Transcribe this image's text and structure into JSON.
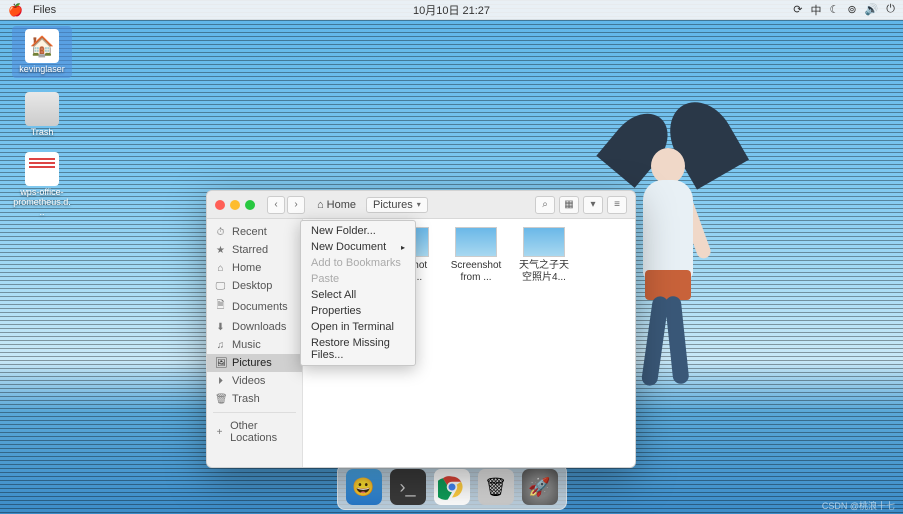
{
  "topbar": {
    "app_name": "Files",
    "clock": "10月10日  21:27"
  },
  "desktop_icons": {
    "home_label": "kevinglaser",
    "trash_label": "Trash",
    "doc_label": "wps-office-prometheus.d..."
  },
  "window": {
    "path_home": "Home",
    "path_current": "Pictures"
  },
  "sidebar": {
    "items": [
      {
        "icon": "⏱",
        "label": "Recent"
      },
      {
        "icon": "★",
        "label": "Starred"
      },
      {
        "icon": "⌂",
        "label": "Home"
      },
      {
        "icon": "🖵",
        "label": "Desktop"
      },
      {
        "icon": "🗎",
        "label": "Documents"
      },
      {
        "icon": "⬇",
        "label": "Downloads"
      },
      {
        "icon": "♫",
        "label": "Music"
      },
      {
        "icon": "🖼",
        "label": "Pictures"
      },
      {
        "icon": "⏵",
        "label": "Videos"
      },
      {
        "icon": "🗑",
        "label": "Trash"
      }
    ],
    "other": "Other Locations"
  },
  "files": [
    {
      "thumb": "txt",
      "name": "..."
    },
    {
      "thumb": "img",
      "name": "eens hot rom ..."
    },
    {
      "thumb": "img",
      "name": "Screenshot from ..."
    },
    {
      "thumb": "img",
      "name": "天气之子天空照片4..."
    }
  ],
  "context_menu": [
    {
      "label": "New Folder...",
      "enabled": true,
      "submenu": false
    },
    {
      "label": "New Document",
      "enabled": true,
      "submenu": true
    },
    {
      "label": "Add to Bookmarks",
      "enabled": false,
      "submenu": false
    },
    {
      "label": "Paste",
      "enabled": false,
      "submenu": false
    },
    {
      "label": "Select All",
      "enabled": true,
      "submenu": false
    },
    {
      "label": "Properties",
      "enabled": true,
      "submenu": false
    },
    {
      "label": "Open in Terminal",
      "enabled": true,
      "submenu": false
    },
    {
      "label": "Restore Missing Files...",
      "enabled": true,
      "submenu": false
    }
  ],
  "watermark": "CSDN @桃浪十七"
}
